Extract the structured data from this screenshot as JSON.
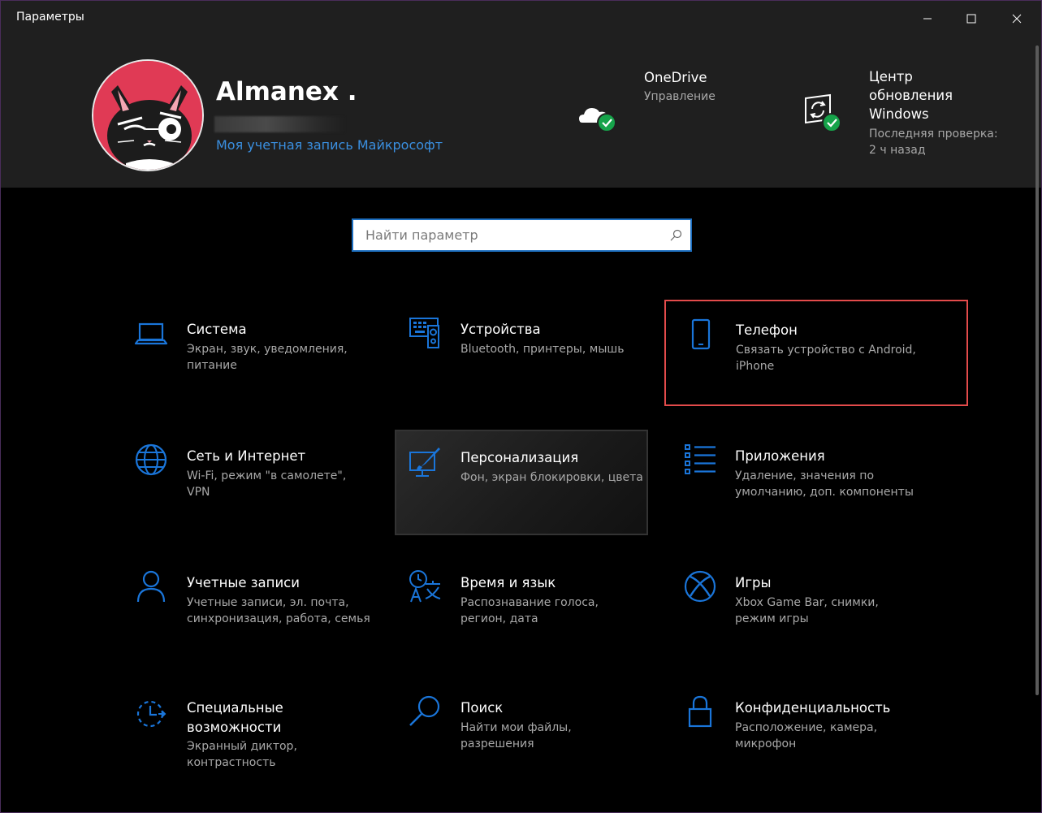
{
  "window": {
    "title": "Параметры"
  },
  "header": {
    "user_name": "Almanex .",
    "account_link": "Моя учетная запись Майкрософт",
    "onedrive": {
      "title": "OneDrive",
      "subtitle": "Управление"
    },
    "update": {
      "title_lines": [
        "Центр",
        "обновления",
        "Windows"
      ],
      "subtitle_lines": [
        "Последняя проверка:",
        "2 ч назад"
      ]
    }
  },
  "search": {
    "placeholder": "Найти параметр"
  },
  "colors": {
    "accent": "#1a75d9",
    "highlight": "#e34b4b",
    "check": "#16a34a"
  },
  "tiles": [
    {
      "icon": "laptop-icon",
      "title_lines": [
        "Система"
      ],
      "desc_lines": [
        "Экран, звук, уведомления,",
        "питание"
      ]
    },
    {
      "icon": "devices-icon",
      "title_lines": [
        "Устройства"
      ],
      "desc_lines": [
        "Bluetooth, принтеры, мышь"
      ]
    },
    {
      "icon": "phone-icon",
      "title_lines": [
        "Телефон"
      ],
      "desc_lines": [
        "Связать устройство с Android,",
        "iPhone"
      ]
    },
    {
      "icon": "globe-icon",
      "title_lines": [
        "Сеть и Интернет"
      ],
      "desc_lines": [
        "Wi-Fi, режим \"в самолете\",",
        "VPN"
      ]
    },
    {
      "icon": "paintbrush-icon",
      "title_lines": [
        "Персонализация"
      ],
      "desc_lines": [
        "Фон, экран блокировки, цвета"
      ]
    },
    {
      "icon": "apps-list-icon",
      "title_lines": [
        "Приложения"
      ],
      "desc_lines": [
        "Удаление, значения по",
        "умолчанию, доп. компоненты"
      ]
    },
    {
      "icon": "person-icon",
      "title_lines": [
        "Учетные записи"
      ],
      "desc_lines": [
        "Учетные записи, эл. почта,",
        "синхронизация, работа, семья"
      ]
    },
    {
      "icon": "time-language-icon",
      "title_lines": [
        "Время и язык"
      ],
      "desc_lines": [
        "Распознавание голоса,",
        "регион, дата"
      ]
    },
    {
      "icon": "xbox-icon",
      "title_lines": [
        "Игры"
      ],
      "desc_lines": [
        "Xbox Game Bar, снимки,",
        "режим игры"
      ]
    },
    {
      "icon": "accessibility-icon",
      "title_lines": [
        "Специальные",
        "возможности"
      ],
      "desc_lines": [
        "Экранный диктор,",
        "контрастность"
      ]
    },
    {
      "icon": "search-magnifier-icon",
      "title_lines": [
        "Поиск"
      ],
      "desc_lines": [
        "Найти мои файлы,",
        "разрешения"
      ]
    },
    {
      "icon": "lock-icon",
      "title_lines": [
        "Конфиденциальность"
      ],
      "desc_lines": [
        "Расположение, камера,",
        "микрофон"
      ]
    }
  ]
}
